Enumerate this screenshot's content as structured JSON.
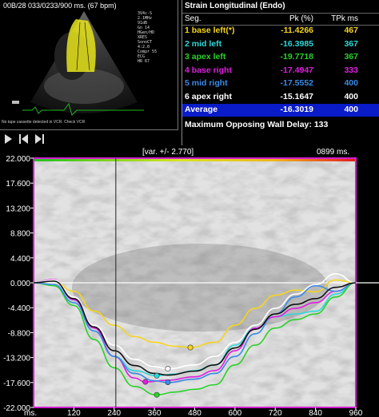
{
  "echo": {
    "header": "00B/28   033/0233/900 ms.   (67 bpm)",
    "meta_lines": [
      "3V4c-S",
      "2.1MHz",
      "91dB",
      "Gn 14",
      "HGen/HD",
      "XRES",
      "SonoCT",
      "4:2.0",
      "Compr 55",
      "ECG",
      "HR 67"
    ],
    "footer": "No tape cassette detected in VCR. Check VCR"
  },
  "controls": [
    "play-icon",
    "step-back-icon",
    "step-forward-icon"
  ],
  "table": {
    "title": "Strain Longitudinal (Endo)",
    "headers": {
      "seg": "Seg.",
      "pk": "Pk (%)",
      "tpk": "TPk ms"
    },
    "rows": [
      {
        "seg": "1 base left(*)",
        "pk": "-11.4266",
        "tpk": "467",
        "color": "#f5d51c"
      },
      {
        "seg": "2 mid left",
        "pk": "-16.3985",
        "tpk": "367",
        "color": "#2cd8d8"
      },
      {
        "seg": "3 apex left",
        "pk": "-19.7718",
        "tpk": "367",
        "color": "#2ad12a"
      },
      {
        "seg": "4 base right",
        "pk": "-17.4947",
        "tpk": "333",
        "color": "#e01ee0"
      },
      {
        "seg": "5 mid right",
        "pk": "-17.5552",
        "tpk": "400",
        "color": "#3a8be8"
      },
      {
        "seg": "6 apex right",
        "pk": "-15.1647",
        "tpk": "400",
        "color": "#ffffff"
      },
      {
        "seg": "Average",
        "pk": "-16.3019",
        "tpk": "400",
        "color": "#ffffff"
      }
    ],
    "delay_label": "Maximum Opposing Wall Delay:",
    "delay_value": "133"
  },
  "chart_data": {
    "type": "line",
    "var_label": "[var. +/- 2.770]",
    "time_label": "0899  ms.",
    "x_unit": "ms.",
    "xlim": [
      0,
      960
    ],
    "ylim": [
      -22,
      22
    ],
    "x_ticks": [
      "120",
      "240",
      "360",
      "480",
      "600",
      "720",
      "840",
      "960"
    ],
    "y_ticks": [
      "22.000",
      "17.600",
      "13.200",
      "8.800",
      "4.400",
      "0.000",
      "-4.400",
      "-8.800",
      "-13.200",
      "-17.600",
      "-22.000"
    ],
    "cursor_ms": 245,
    "series": [
      {
        "color": "#f5d51c",
        "x": [
          0,
          60,
          120,
          180,
          240,
          300,
          360,
          420,
          467,
          540,
          600,
          660,
          720,
          780,
          840,
          900,
          960
        ],
        "y": [
          0,
          0.3,
          -1.5,
          -5,
          -7.5,
          -9.5,
          -10.5,
          -11.2,
          -11.4,
          -10.5,
          -7.5,
          -4.5,
          -2.2,
          -1.3,
          -1.6,
          0.5,
          0
        ]
      },
      {
        "color": "#2cd8d8",
        "x": [
          0,
          60,
          120,
          180,
          240,
          300,
          367,
          420,
          480,
          540,
          600,
          660,
          720,
          780,
          840,
          900,
          960
        ],
        "y": [
          0,
          0.4,
          -3,
          -8.5,
          -13,
          -15.5,
          -16.4,
          -16.1,
          -15.5,
          -14.5,
          -11,
          -8,
          -6,
          -5.5,
          -5,
          -2,
          0
        ]
      },
      {
        "color": "#2ad12a",
        "x": [
          0,
          60,
          120,
          180,
          240,
          300,
          367,
          420,
          480,
          540,
          600,
          660,
          720,
          780,
          840,
          900,
          960
        ],
        "y": [
          0,
          -0.5,
          -4,
          -10,
          -15,
          -18.3,
          -19.8,
          -19.3,
          -18.8,
          -18,
          -14.5,
          -11,
          -8,
          -6.5,
          -5.5,
          -2.5,
          0
        ]
      },
      {
        "color": "#e01ee0",
        "x": [
          0,
          60,
          120,
          180,
          240,
          300,
          333,
          400,
          480,
          540,
          600,
          660,
          720,
          780,
          840,
          900,
          960
        ],
        "y": [
          0,
          0.6,
          -3,
          -8,
          -13,
          -16.8,
          -17.5,
          -17.2,
          -16.6,
          -15.5,
          -12,
          -8,
          -6,
          -4.5,
          -3.5,
          -1.5,
          0
        ]
      },
      {
        "color": "#3a8be8",
        "x": [
          0,
          60,
          120,
          180,
          240,
          300,
          360,
          400,
          480,
          540,
          600,
          660,
          720,
          780,
          840,
          900,
          960
        ],
        "y": [
          0,
          -0.3,
          -3.5,
          -8.5,
          -13,
          -16,
          -17.3,
          -17.6,
          -17,
          -16,
          -13,
          -9,
          -5.5,
          -2.5,
          -0.5,
          -1.5,
          0
        ]
      },
      {
        "color": "#ffffff",
        "x": [
          0,
          60,
          120,
          180,
          240,
          300,
          360,
          400,
          480,
          540,
          600,
          660,
          720,
          780,
          840,
          900,
          960
        ],
        "y": [
          0,
          0.5,
          -2.5,
          -7.5,
          -11,
          -13.5,
          -14.8,
          -15.2,
          -14.5,
          -13,
          -10.5,
          -7.5,
          -4.5,
          -2,
          -0.3,
          1.6,
          0
        ]
      },
      {
        "color": "#111111",
        "x": [
          0,
          60,
          120,
          180,
          240,
          300,
          360,
          400,
          480,
          540,
          600,
          660,
          720,
          780,
          840,
          900,
          960
        ],
        "y": [
          0,
          0.3,
          -2.8,
          -7.8,
          -12,
          -14.6,
          -16,
          -16.3,
          -15.6,
          -14.5,
          -11.5,
          -8.2,
          -5.5,
          -3.8,
          -2.8,
          -0.8,
          0
        ]
      }
    ],
    "peak_markers": [
      {
        "color": "#f5d51c",
        "x": 467,
        "y": -11.4266
      },
      {
        "color": "#2cd8d8",
        "x": 367,
        "y": -16.3985
      },
      {
        "color": "#2ad12a",
        "x": 367,
        "y": -19.7718
      },
      {
        "color": "#e01ee0",
        "x": 333,
        "y": -17.4947
      },
      {
        "color": "#3a8be8",
        "x": 400,
        "y": -17.5552
      },
      {
        "color": "#ffffff",
        "x": 400,
        "y": -15.1647
      }
    ]
  }
}
